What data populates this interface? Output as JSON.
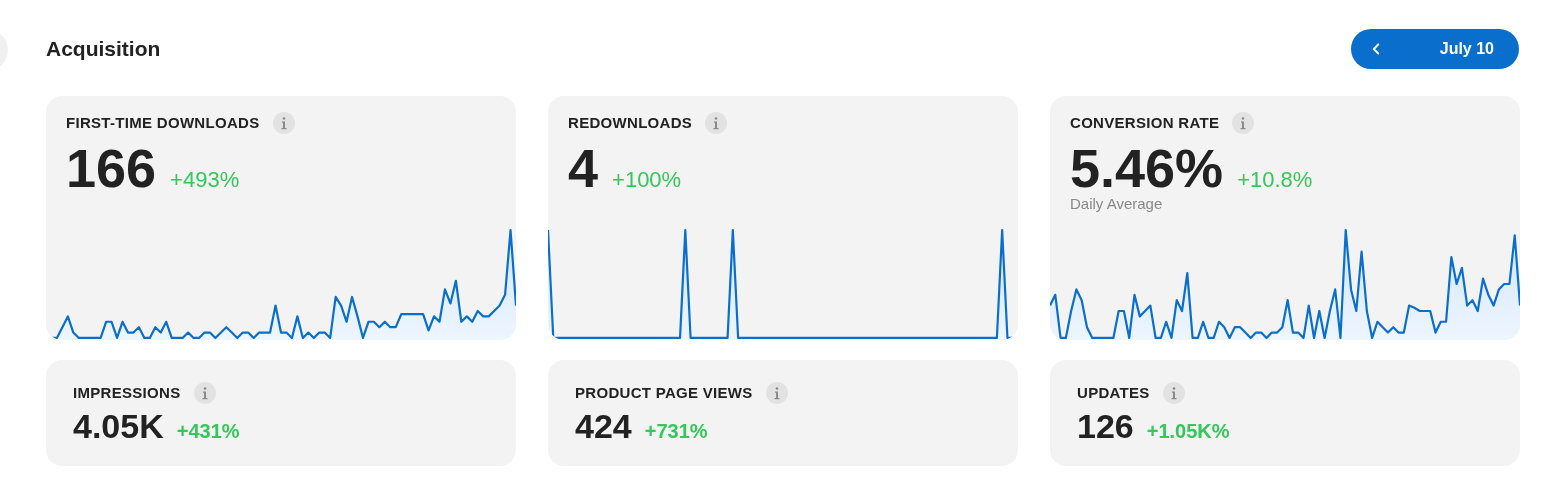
{
  "header": {
    "title": "Acquisition",
    "date_button": "July 10"
  },
  "metric_cards": [
    {
      "label": "FIRST-TIME DOWNLOADS",
      "value": "166",
      "change": "+493%"
    },
    {
      "label": "REDOWNLOADS",
      "value": "4",
      "change": "+100%"
    },
    {
      "label": "CONVERSION RATE",
      "value": "5.46%",
      "change": "+10.8%",
      "note": "Daily Average"
    }
  ],
  "summary_cards": [
    {
      "label": "IMPRESSIONS",
      "value": "4.05K",
      "change": "+431%"
    },
    {
      "label": "PRODUCT PAGE VIEWS",
      "value": "424",
      "change": "+731%"
    },
    {
      "label": "UPDATES",
      "value": "126",
      "change": "+1.05K%"
    }
  ]
}
